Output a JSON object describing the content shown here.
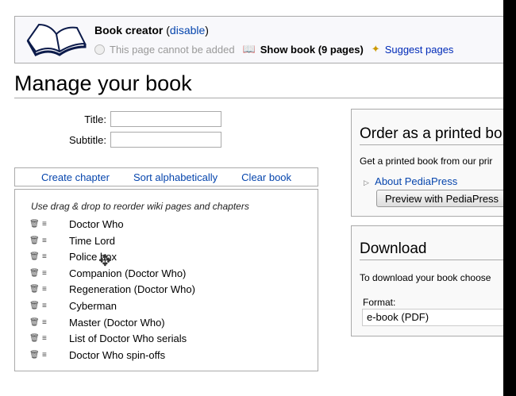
{
  "creator": {
    "title": "Book creator",
    "disable_open": "(",
    "disable": "disable",
    "disable_close": ")",
    "cannot_add": "This page cannot be added",
    "show_book": "Show book (9 pages)",
    "suggest": "Suggest pages"
  },
  "heading": "Manage your book",
  "form": {
    "title_label": "Title:",
    "title_value": "",
    "subtitle_label": "Subtitle:",
    "subtitle_value": ""
  },
  "toolbar": {
    "create_chapter": "Create chapter",
    "sort": "Sort alphabetically",
    "clear": "Clear book"
  },
  "list": {
    "hint": "Use drag & drop to reorder wiki pages and chapters",
    "items": [
      "Doctor Who",
      "Time Lord",
      "Police box",
      "Companion (Doctor Who)",
      "Regeneration (Doctor Who)",
      "Cyberman",
      "Master (Doctor Who)",
      "List of Doctor Who serials",
      "Doctor Who spin-offs"
    ]
  },
  "order": {
    "heading": "Order as a printed bo",
    "text": "Get a printed book from our prir",
    "about": "About PediaPress",
    "preview": "Preview with PediaPress"
  },
  "download": {
    "heading": "Download",
    "text": "To download your book choose",
    "format_label": "Format:",
    "format_value": "e-book (PDF)"
  }
}
